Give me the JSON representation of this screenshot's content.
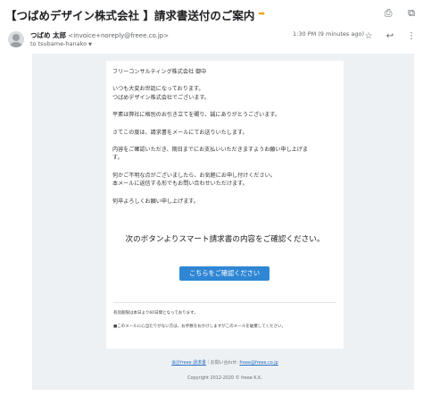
{
  "email": {
    "subject": "【つばめデザイン株式会社 】請求書送付のご案内",
    "subject_badge_icon": "label-arrow-icon",
    "from_name": "つばめ 太郎",
    "from_address": "<invoice+noreply@freee.co.jp>",
    "to": "to tsubame-hanako",
    "time": "1:30 PM (9 minutes ago)"
  },
  "actions": {
    "top": [
      "print-icon",
      "open-new-window-icon"
    ],
    "header": [
      "star-icon",
      "reply-icon",
      "more-icon"
    ]
  },
  "body": {
    "recipient": "フリーコンサルティング株式会社 御中",
    "greeting_1": "いつも大変お世話になっております。",
    "greeting_2": "つばめデザイン株式会社でございます。",
    "thanks": "平素は弊社に格別のお引き立てを賜り、誠にありがとうございます。",
    "notice": "さてこの度は、請求書をメールにてお送りいたします。",
    "request_1": "内容をご確認いただき、期日までにお支払いいただきますようお願い申し上げま",
    "request_2": "す。",
    "contact_1": "何かご不明な点がございましたら、お気軽にお申し付けください。",
    "contact_2": "本メールに返信する形でもお問い合わせいただけます。",
    "closing": "何卒よろしくお願い申し上げます。"
  },
  "cta": {
    "heading": "次のボタンよりスマート請求書の内容をご確認ください。",
    "button_label": "こちらをご確認ください"
  },
  "notes": {
    "validity": "有効期限は本日より60日間となっております。",
    "ignore": "■このメールに心当たりがない方は、お手数をおかけしますがこのメールを破棄してください。"
  },
  "footer": {
    "link_service": "会計freee 請求書",
    "separator": "｜",
    "contact_prefix": "お問い合わせ:",
    "contact_email": "freee@freee.co.jp",
    "copyright": "Copyright 2012-2020 © freee K.K."
  },
  "colors": {
    "button": "#2f86d4",
    "mail_background": "#edf1f4",
    "link": "#2f6fc0"
  }
}
